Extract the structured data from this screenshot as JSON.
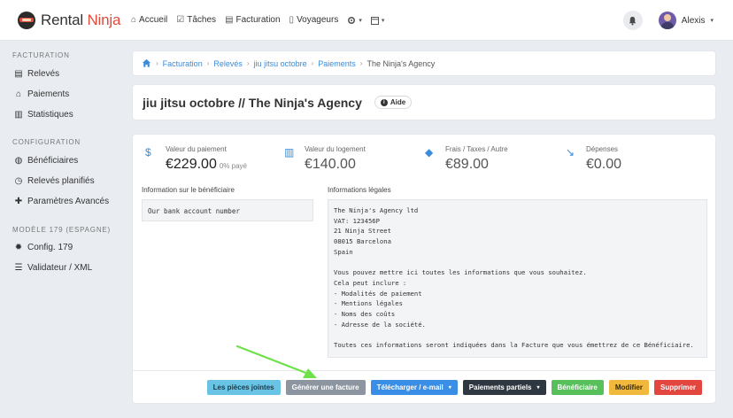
{
  "brand": {
    "part1": "Rental",
    "part2": "Ninja"
  },
  "topnav": {
    "items": [
      {
        "icon": "⌂",
        "label": "Accueil"
      },
      {
        "icon": "☑",
        "label": "Tâches"
      },
      {
        "icon": "▤",
        "label": "Facturation"
      },
      {
        "icon": "▯",
        "label": "Voyageurs"
      }
    ],
    "gear_caret": "▾",
    "cal_caret": "▾"
  },
  "user": {
    "name": "Alexis",
    "caret": "▾"
  },
  "sidebar": {
    "sections": [
      {
        "heading": "FACTURATION",
        "items": [
          "Relevés",
          "Paiements",
          "Statistiques"
        ]
      },
      {
        "heading": "CONFIGURATION",
        "items": [
          "Bénéficiaires",
          "Relevés planifiés",
          "Paramètres Avancés"
        ]
      },
      {
        "heading": "MODÈLE 179 (ESPAGNE)",
        "items": [
          "Config. 179",
          "Validateur / XML"
        ]
      }
    ]
  },
  "breadcrumb": {
    "items": [
      "Facturation",
      "Relevés",
      "jiu jitsu octobre",
      "Paiements"
    ],
    "current": "The Ninja's Agency",
    "separator": "›"
  },
  "title": {
    "text": "jiu jitsu octobre // The Ninja's Agency",
    "help_label": "Aide"
  },
  "stats": [
    {
      "label": "Valeur du paiement",
      "value": "€229.00",
      "sub": "0% payé",
      "icon": "$"
    },
    {
      "label": "Valeur du logement",
      "value": "€140.00",
      "icon": "▥"
    },
    {
      "label": "Frais / Taxes / Autre",
      "value": "€89.00",
      "icon": "◆"
    },
    {
      "label": "Dépenses",
      "value": "€0.00",
      "icon": "↘"
    }
  ],
  "beneficiary": {
    "label": "Information sur le bénéficiaire",
    "text": "Our bank account number"
  },
  "legal": {
    "label": "Informations légales",
    "text": "The Ninja's Agency ltd\nVAT: 123456P\n21 Ninja Street\n08015 Barcelona\nSpain\n\nVous pouvez mettre ici toutes les informations que vous souhaitez.\nCela peut inclure :\n- Modalités de paiement\n- Mentions légales\n- Noms des coûts\n- Adresse de la société.\n\nToutes ces informations seront indiquées dans la Facture que vous émettrez de ce Bénéficiaire."
  },
  "buttons": {
    "attachments": "Les pièces jointes",
    "generate": "Générer une facture",
    "download": "Télécharger / e-mail",
    "partial": "Paiements partiels",
    "beneficiary": "Bénéficiaire",
    "edit": "Modifier",
    "delete": "Supprimer",
    "caret": "▾"
  },
  "colors": {
    "brand_red": "#e14b3b",
    "link_blue": "#3a8bd8",
    "arrow_green": "#6ee04a"
  }
}
